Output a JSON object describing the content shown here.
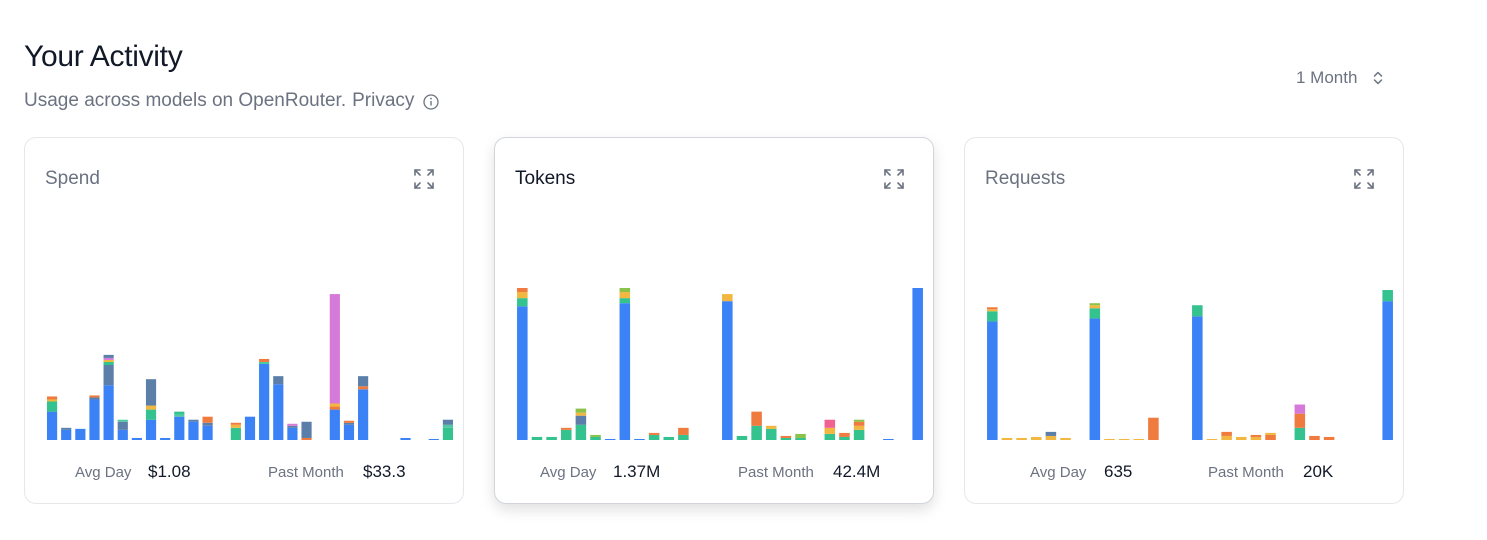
{
  "header": {
    "title": "Your Activity",
    "subtitle": "Usage across models on OpenRouter.",
    "privacy_link": "Privacy",
    "info_icon": "info-icon"
  },
  "range_select": {
    "value": "1 Month",
    "icon": "chevron-up-down-icon"
  },
  "colors": {
    "blue": "#3b82f6",
    "slate": "#5b7fa8",
    "green": "#34c38f",
    "teal": "#4ec9a0",
    "orange": "#f07b3f",
    "yellow": "#f2b740",
    "magenta": "#d67ad9",
    "lime": "#8bc34a",
    "pink": "#f06292"
  },
  "cards": [
    {
      "title": "Spend",
      "expand_icon": "expand-icon",
      "avg_label": "Avg Day",
      "avg_value": "$1.08",
      "total_label": "Past Month",
      "total_value": "$33.3"
    },
    {
      "title": "Tokens",
      "expand_icon": "expand-icon",
      "avg_label": "Avg Day",
      "avg_value": "1.37M",
      "total_label": "Past Month",
      "total_value": "42.4M"
    },
    {
      "title": "Requests",
      "expand_icon": "expand-icon",
      "avg_label": "Avg Day",
      "avg_value": "635",
      "total_label": "Past Month",
      "total_value": "20K"
    }
  ],
  "chart_data": [
    {
      "type": "bar",
      "stacked": true,
      "title": "Spend",
      "ylim": [
        0,
        150
      ],
      "bars": [
        [
          {
            "c": "blue",
            "v": 28
          },
          {
            "c": "green",
            "v": 10
          },
          {
            "c": "yellow",
            "v": 2
          },
          {
            "c": "orange",
            "v": 3
          }
        ],
        [
          {
            "c": "blue",
            "v": 10
          },
          {
            "c": "slate",
            "v": 2
          }
        ],
        [
          {
            "c": "blue",
            "v": 11
          }
        ],
        [
          {
            "c": "blue",
            "v": 40
          },
          {
            "c": "slate",
            "v": 2
          },
          {
            "c": "orange",
            "v": 2
          }
        ],
        [
          {
            "c": "blue",
            "v": 54
          },
          {
            "c": "slate",
            "v": 20
          },
          {
            "c": "green",
            "v": 3
          },
          {
            "c": "yellow",
            "v": 2
          },
          {
            "c": "magenta",
            "v": 2
          },
          {
            "c": "slate",
            "v": 3
          }
        ],
        [
          {
            "c": "blue",
            "v": 10
          },
          {
            "c": "slate",
            "v": 8
          },
          {
            "c": "teal",
            "v": 2
          }
        ],
        [
          {
            "c": "blue",
            "v": 2
          }
        ],
        [
          {
            "c": "blue",
            "v": 20
          },
          {
            "c": "green",
            "v": 10
          },
          {
            "c": "yellow",
            "v": 4
          },
          {
            "c": "slate",
            "v": 26
          }
        ],
        [
          {
            "c": "blue",
            "v": 2
          }
        ],
        [
          {
            "c": "blue",
            "v": 23
          },
          {
            "c": "teal",
            "v": 2
          },
          {
            "c": "green",
            "v": 3
          }
        ],
        [
          {
            "c": "blue",
            "v": 18
          },
          {
            "c": "slate",
            "v": 2
          }
        ],
        [
          {
            "c": "blue",
            "v": 14
          },
          {
            "c": "slate",
            "v": 3
          },
          {
            "c": "orange",
            "v": 6
          }
        ],
        [],
        [
          {
            "c": "green",
            "v": 12
          },
          {
            "c": "yellow",
            "v": 3
          },
          {
            "c": "orange",
            "v": 2
          }
        ],
        [
          {
            "c": "blue",
            "v": 23
          }
        ],
        [
          {
            "c": "blue",
            "v": 75
          },
          {
            "c": "teal",
            "v": 2
          },
          {
            "c": "orange",
            "v": 3
          }
        ],
        [
          {
            "c": "blue",
            "v": 55
          },
          {
            "c": "slate",
            "v": 8
          }
        ],
        [
          {
            "c": "blue",
            "v": 12
          },
          {
            "c": "slate",
            "v": 2
          },
          {
            "c": "magenta",
            "v": 2
          }
        ],
        [
          {
            "c": "orange",
            "v": 2
          },
          {
            "c": "slate",
            "v": 16
          }
        ],
        [],
        [
          {
            "c": "blue",
            "v": 30
          },
          {
            "c": "orange",
            "v": 3
          },
          {
            "c": "yellow",
            "v": 3
          },
          {
            "c": "magenta",
            "v": 108
          }
        ],
        [
          {
            "c": "blue",
            "v": 15
          },
          {
            "c": "slate",
            "v": 2
          },
          {
            "c": "orange",
            "v": 2
          }
        ],
        [
          {
            "c": "blue",
            "v": 50
          },
          {
            "c": "orange",
            "v": 3
          },
          {
            "c": "slate",
            "v": 10
          }
        ],
        [],
        [],
        [
          {
            "c": "blue",
            "v": 2
          }
        ],
        [],
        [
          {
            "c": "blue",
            "v": 1
          }
        ],
        [
          {
            "c": "green",
            "v": 12
          },
          {
            "c": "teal",
            "v": 3
          },
          {
            "c": "slate",
            "v": 5
          }
        ]
      ]
    },
    {
      "type": "bar",
      "stacked": true,
      "title": "Tokens",
      "ylim": [
        0,
        150
      ],
      "bars": [
        [
          {
            "c": "blue",
            "v": 132
          },
          {
            "c": "green",
            "v": 8
          },
          {
            "c": "yellow",
            "v": 6
          },
          {
            "c": "orange",
            "v": 4
          }
        ],
        [
          {
            "c": "green",
            "v": 3
          }
        ],
        [
          {
            "c": "green",
            "v": 3
          }
        ],
        [
          {
            "c": "green",
            "v": 10
          },
          {
            "c": "orange",
            "v": 2
          }
        ],
        [
          {
            "c": "green",
            "v": 15
          },
          {
            "c": "slate",
            "v": 9
          },
          {
            "c": "yellow",
            "v": 3
          },
          {
            "c": "lime",
            "v": 4
          }
        ],
        [
          {
            "c": "green",
            "v": 3
          },
          {
            "c": "lime",
            "v": 2
          }
        ],
        [
          {
            "c": "blue",
            "v": 1
          }
        ],
        [
          {
            "c": "blue",
            "v": 135
          },
          {
            "c": "green",
            "v": 5
          },
          {
            "c": "yellow",
            "v": 6
          },
          {
            "c": "lime",
            "v": 6
          }
        ],
        [
          {
            "c": "blue",
            "v": 1
          }
        ],
        [
          {
            "c": "green",
            "v": 5
          },
          {
            "c": "orange",
            "v": 2
          }
        ],
        [
          {
            "c": "green",
            "v": 3
          }
        ],
        [
          {
            "c": "green",
            "v": 5
          },
          {
            "c": "orange",
            "v": 7
          }
        ],
        [],
        [],
        [
          {
            "c": "blue",
            "v": 137
          },
          {
            "c": "yellow",
            "v": 7
          }
        ],
        [
          {
            "c": "green",
            "v": 4
          }
        ],
        [
          {
            "c": "green",
            "v": 14
          },
          {
            "c": "orange",
            "v": 14
          }
        ],
        [
          {
            "c": "green",
            "v": 11
          },
          {
            "c": "yellow",
            "v": 3
          }
        ],
        [
          {
            "c": "green",
            "v": 2
          },
          {
            "c": "orange",
            "v": 2
          }
        ],
        [
          {
            "c": "green",
            "v": 2
          },
          {
            "c": "lime",
            "v": 4
          }
        ],
        [],
        [
          {
            "c": "green",
            "v": 6
          },
          {
            "c": "yellow",
            "v": 6
          },
          {
            "c": "pink",
            "v": 8
          }
        ],
        [
          {
            "c": "green",
            "v": 3
          },
          {
            "c": "orange",
            "v": 4
          }
        ],
        [
          {
            "c": "green",
            "v": 10
          },
          {
            "c": "yellow",
            "v": 4
          },
          {
            "c": "orange",
            "v": 4
          },
          {
            "c": "lime",
            "v": 2
          }
        ],
        [],
        [
          {
            "c": "blue",
            "v": 1
          }
        ],
        [],
        [
          {
            "c": "blue",
            "v": 152
          },
          {
            "c": "yellow",
            "v": 7
          }
        ]
      ]
    },
    {
      "type": "bar",
      "stacked": true,
      "title": "Requests",
      "ylim": [
        0,
        150
      ],
      "bars": [
        [
          {
            "c": "blue",
            "v": 117
          },
          {
            "c": "green",
            "v": 10
          },
          {
            "c": "yellow",
            "v": 2
          },
          {
            "c": "orange",
            "v": 2
          }
        ],
        [
          {
            "c": "yellow",
            "v": 2
          }
        ],
        [
          {
            "c": "yellow",
            "v": 2
          }
        ],
        [
          {
            "c": "yellow",
            "v": 3
          }
        ],
        [
          {
            "c": "yellow",
            "v": 4
          },
          {
            "c": "slate",
            "v": 4
          }
        ],
        [
          {
            "c": "yellow",
            "v": 2
          }
        ],
        [],
        [
          {
            "c": "blue",
            "v": 120
          },
          {
            "c": "green",
            "v": 10
          },
          {
            "c": "yellow",
            "v": 3
          },
          {
            "c": "lime",
            "v": 2
          }
        ],
        [
          {
            "c": "yellow",
            "v": 1
          }
        ],
        [
          {
            "c": "yellow",
            "v": 1
          }
        ],
        [
          {
            "c": "yellow",
            "v": 1
          }
        ],
        [
          {
            "c": "orange",
            "v": 22
          }
        ],
        [],
        [],
        [
          {
            "c": "blue",
            "v": 122
          },
          {
            "c": "green",
            "v": 11
          }
        ],
        [
          {
            "c": "yellow",
            "v": 1
          }
        ],
        [
          {
            "c": "yellow",
            "v": 4
          },
          {
            "c": "orange",
            "v": 4
          }
        ],
        [
          {
            "c": "yellow",
            "v": 3
          }
        ],
        [
          {
            "c": "yellow",
            "v": 3
          },
          {
            "c": "orange",
            "v": 2
          }
        ],
        [
          {
            "c": "orange",
            "v": 5
          },
          {
            "c": "yellow",
            "v": 2
          }
        ],
        [],
        [
          {
            "c": "green",
            "v": 12
          },
          {
            "c": "orange",
            "v": 14
          },
          {
            "c": "magenta",
            "v": 9
          }
        ],
        [
          {
            "c": "orange",
            "v": 4
          }
        ],
        [
          {
            "c": "orange",
            "v": 3
          }
        ],
        [],
        [],
        [],
        [
          {
            "c": "blue",
            "v": 137
          },
          {
            "c": "green",
            "v": 11
          }
        ]
      ]
    }
  ]
}
